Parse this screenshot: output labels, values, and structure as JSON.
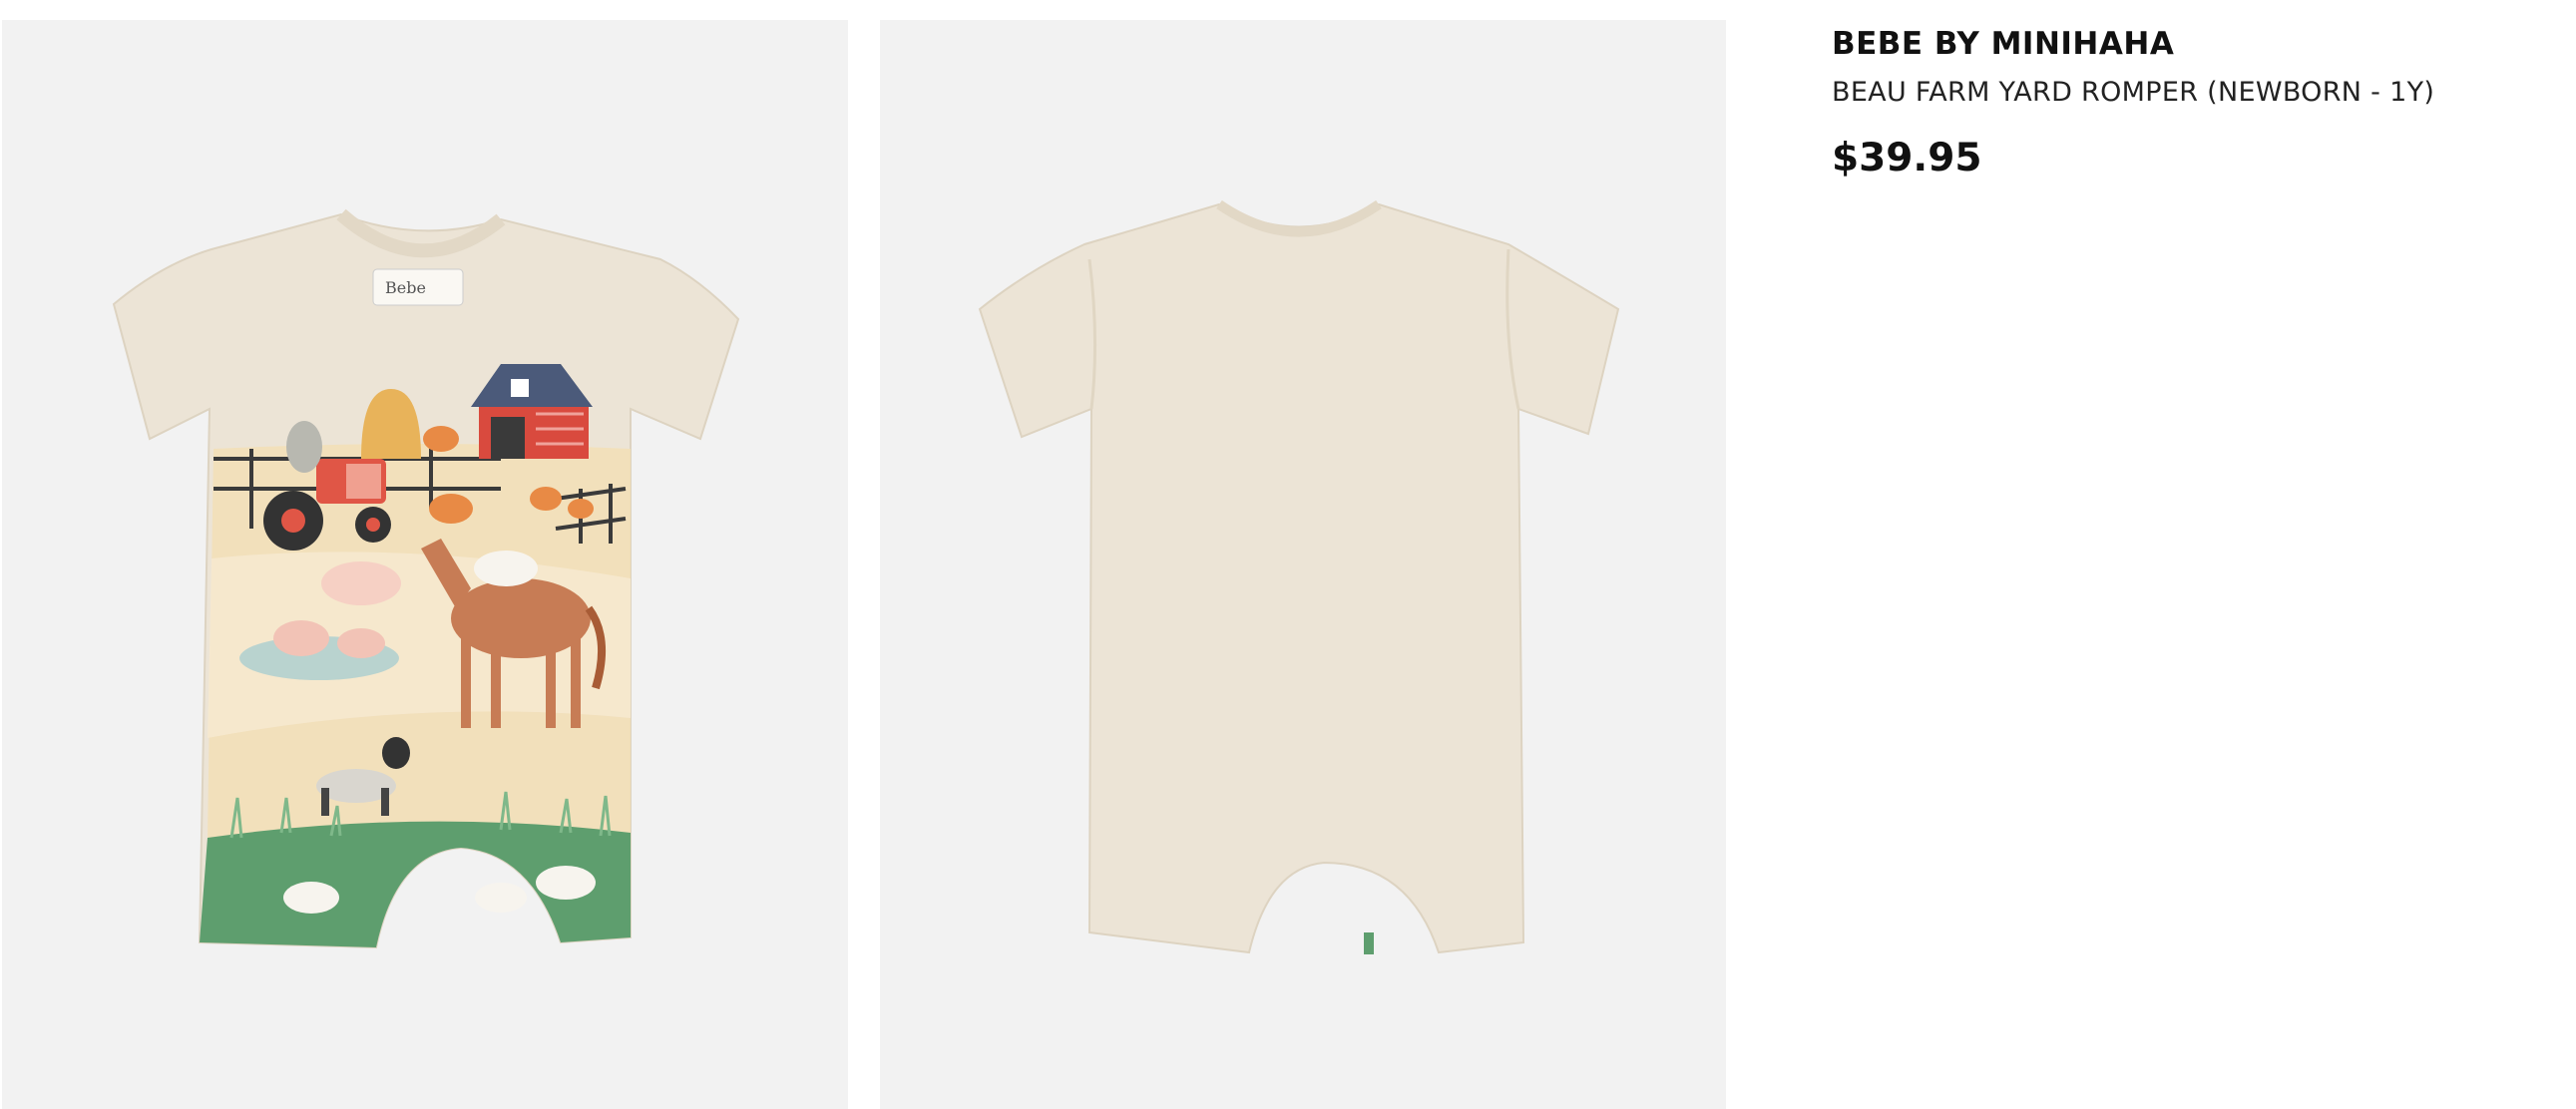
{
  "product": {
    "brand": "BEBE BY MINIHAHA",
    "title": "BEAU FARM YARD ROMPER (NEWBORN - 1Y)",
    "price": "$39.95"
  },
  "images": {
    "front": {
      "name": "romper-front",
      "label_text": "Bebe"
    },
    "back": {
      "name": "romper-back"
    }
  },
  "colors": {
    "image_bg": "#f2f2f2",
    "fabric": "#ece4d6",
    "grass": "#5e9e6e",
    "barn": "#d94a3e"
  }
}
